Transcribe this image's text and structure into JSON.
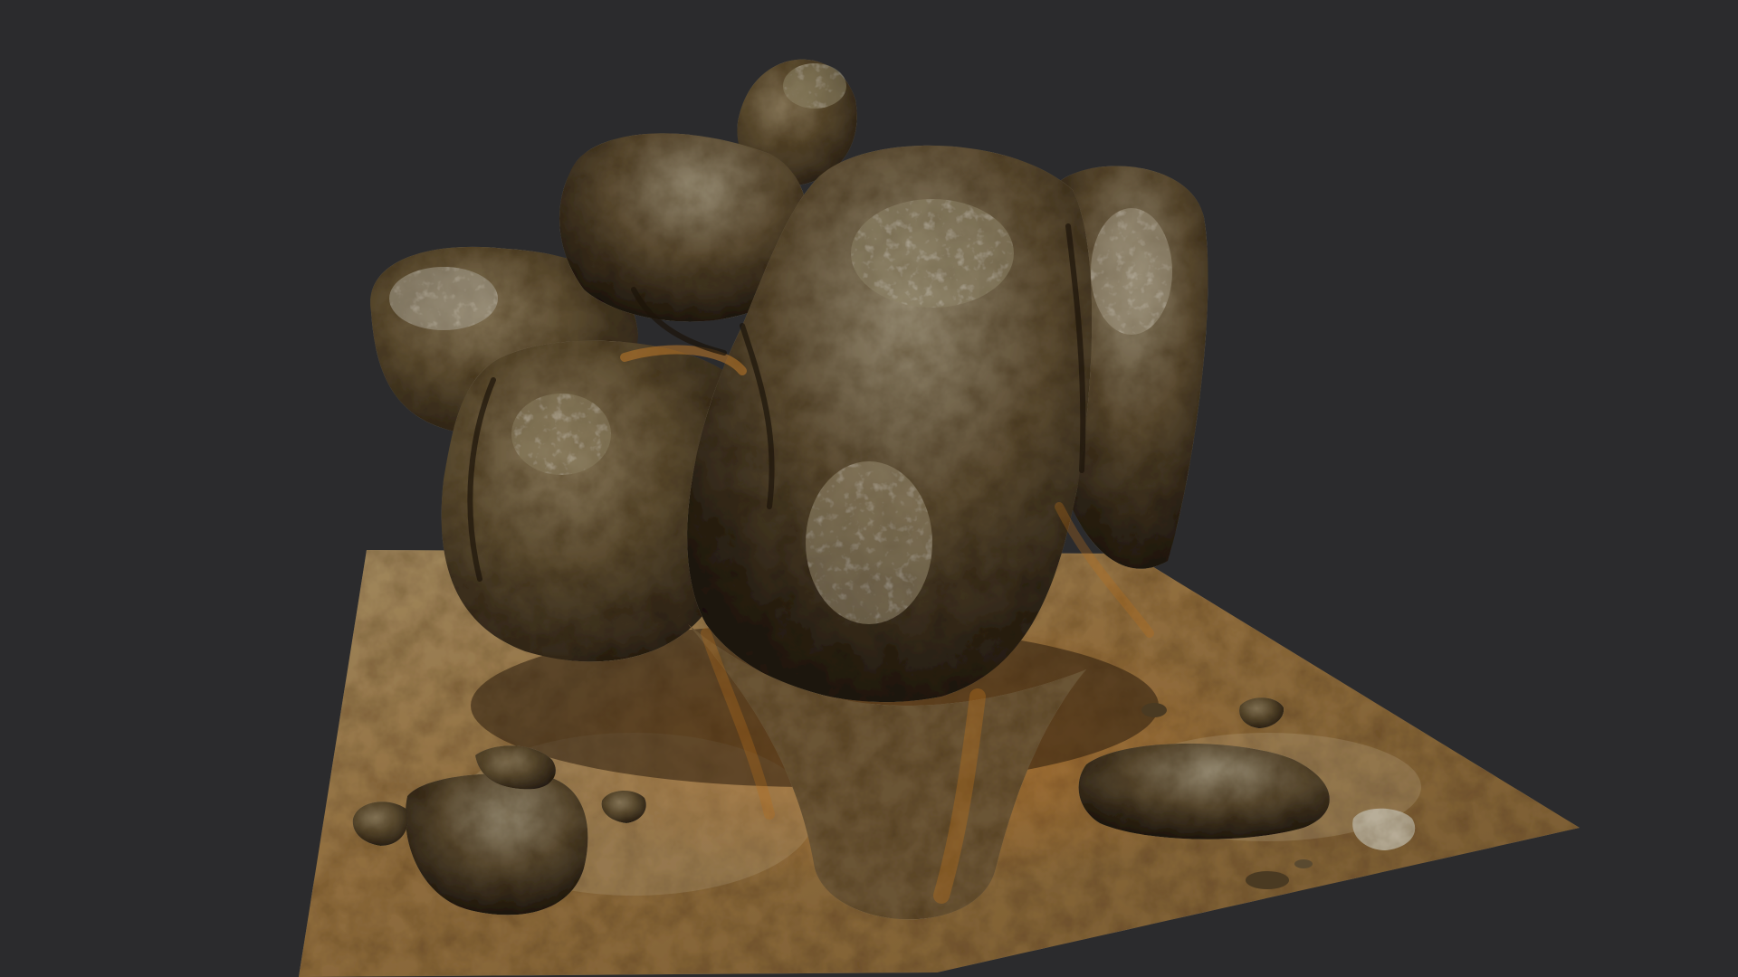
{
  "viewport": {
    "background_color": "#2b2b2d"
  },
  "scene": {
    "subject": "rock-cluster-3d-model",
    "colors": {
      "ground_base": "#8a6a3a",
      "ground_dark": "#5a4222",
      "ground_light": "#b89a6a",
      "rust": "#b0681e",
      "rock_base": "#5e4e32",
      "rock_dark": "#2e2416",
      "rock_light": "#9a8a6e",
      "highlight": "#c8c2b2"
    }
  }
}
